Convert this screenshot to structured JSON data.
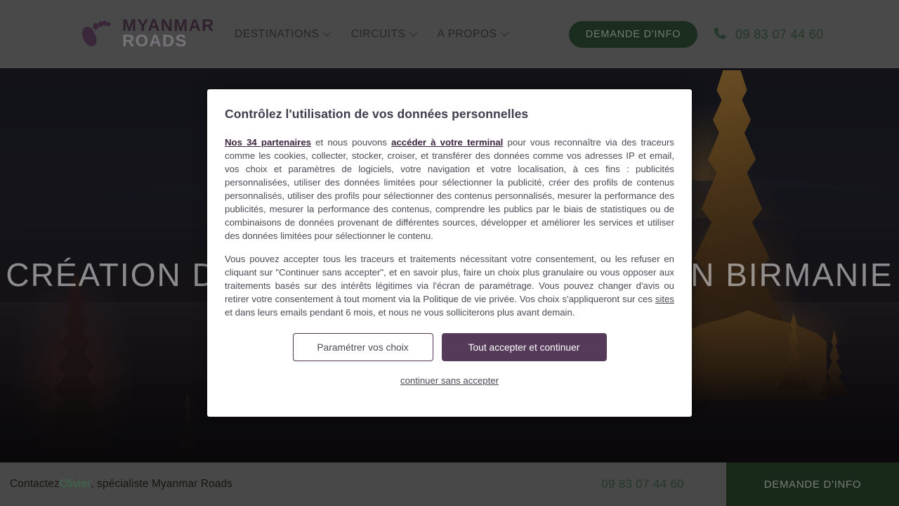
{
  "header": {
    "logo": {
      "icon": "footprint-icon",
      "line1": "MYANMAR",
      "line2": "ROADS"
    },
    "nav": [
      {
        "label": "DESTINATIONS",
        "icon": "chevron-down-icon"
      },
      {
        "label": "CIRCUITS",
        "icon": "chevron-down-icon"
      },
      {
        "label": "A PROPOS",
        "icon": "chevron-down-icon"
      }
    ],
    "cta_label": "DEMANDE D'INFO",
    "phone_icon": "phone-icon",
    "phone_number": "09 83 07 44 60"
  },
  "hero": {
    "headline": "CRÉATION DE VOYAGES SUR-MESURE EN BIRMANIE"
  },
  "modal": {
    "title": "Contrôlez l'utilisation de vos données personnelles",
    "paragraph1": {
      "link_partners": "Nos 34 partenaires",
      "text_a": " et nous pouvons ",
      "link_terminal": "accéder à votre terminal",
      "text_b": " pour vous reconnaître via des traceurs comme les cookies, collecter, stocker, croiser, et transférer des données comme vos adresses IP et email, vos choix et paramètres de logiciels, votre navigation et votre localisation, à ces fins : publicités personnalisées, utiliser des données limitées pour sélectionner la publicité, créer des profils de contenus personnalisés, utiliser des profils pour sélectionner des contenus personnalisés, mesurer la performance des publicités, mesurer la performance des contenus, comprendre les publics par le biais de statistiques ou de combinaisons de données provenant de différentes sources, développer et améliorer les services et utiliser des données limitées pour sélectionner le contenu."
    },
    "paragraph2": {
      "text_a": "Vous pouvez accepter tous les traceurs et traitements nécessitant votre consentement, ou les refuser en cliquant sur \"Continuer sans accepter\", et en savoir plus, faire un choix plus granulaire ou vous opposer aux traitements basés sur des intérêts légitimes via l'écran de paramétrage. Vous pouvez changer d'avis ou retirer votre consentement à tout moment via la Politique de vie privée. Vos choix s'appliqueront sur ces ",
      "link_sites": "sites",
      "text_b": " et dans leurs emails pendant 6 mois, et nous ne vous solliciterons plus avant demain."
    },
    "btn_settings": "Paramétrer vos choix",
    "btn_accept": "Tout accepter et continuer",
    "link_refuse": "continuer sans accepter"
  },
  "bottom_bar": {
    "contact_prefix": "Contactez ",
    "contact_name": "Olivier",
    "contact_suffix": ", spécialiste Myanmar Roads",
    "phone_number": "09 83 07 44 60",
    "cta_label": "DEMANDE D'INFO"
  },
  "colors": {
    "accent_purple": "#563a5a",
    "accent_green": "#182819",
    "header_bg": "#4d4d4d",
    "logo_dark": "#30212f",
    "logo_gray": "#767278",
    "contact_name_green": "#3d6b4a"
  }
}
